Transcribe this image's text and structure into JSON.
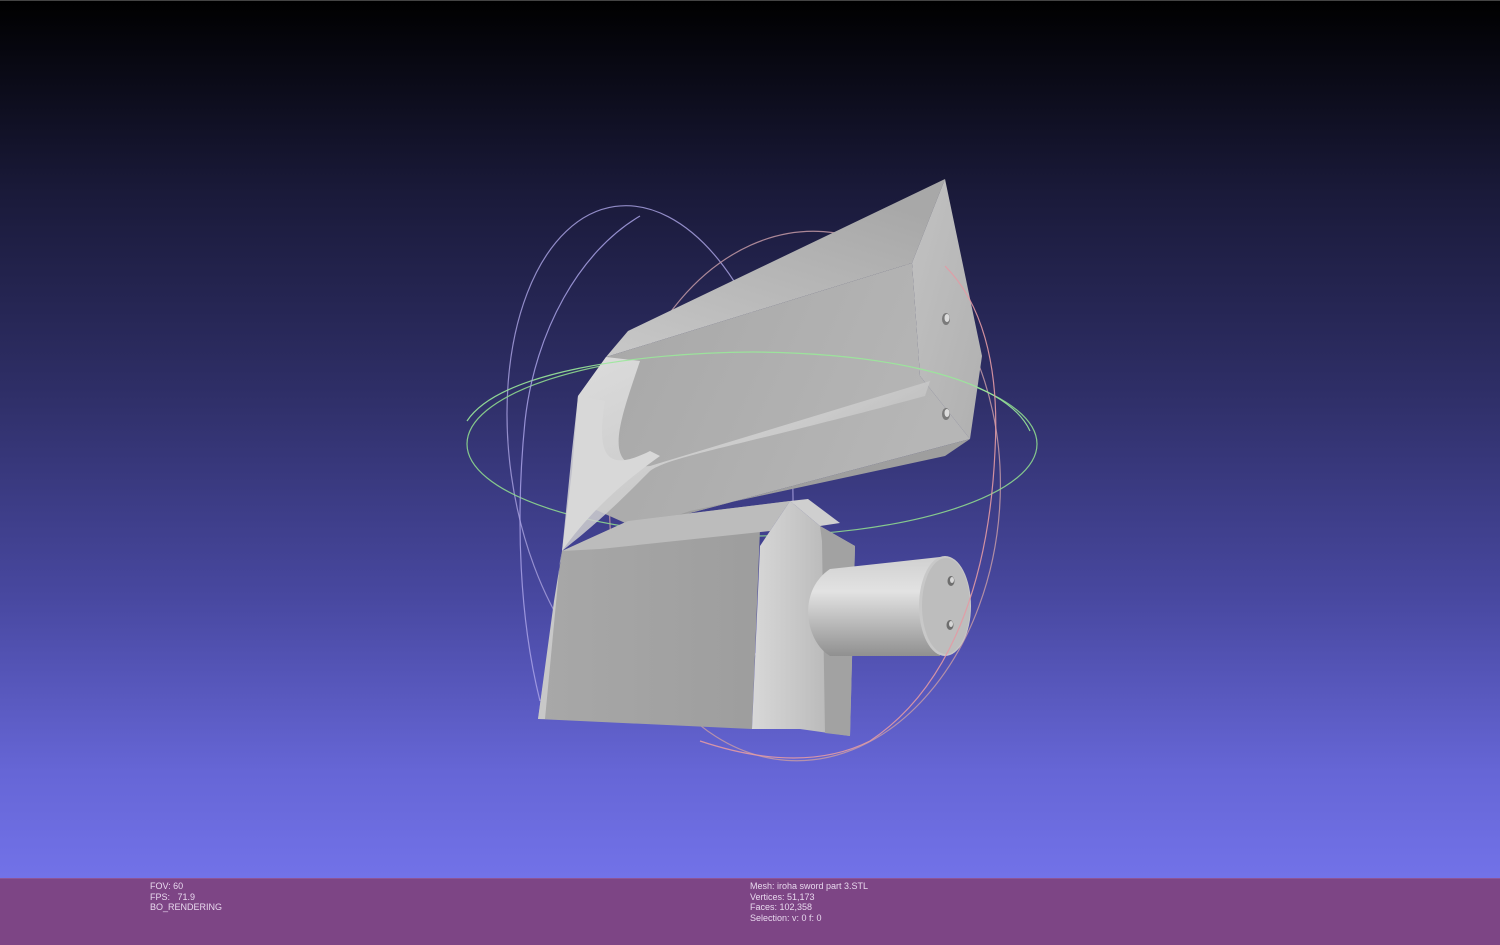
{
  "viewer": {
    "background_top": "#000000",
    "background_bottom": "#7272e8",
    "mesh_color": "#b4b4b4",
    "trackball": {
      "horizontal_ring_color": "#8ee08e",
      "vertical_ring_color": "#b0a8e0",
      "red_ring_color": "#e0909a"
    }
  },
  "status": {
    "fov": "FOV: 60",
    "fps": "FPS:   71.9",
    "render_mode": "BO_RENDERING",
    "mesh": "Mesh: iroha sword part 3.STL",
    "vertices": "Vertices: 51,173",
    "faces": "Faces: 102,358",
    "selection": "Selection: v: 0 f: 0"
  }
}
